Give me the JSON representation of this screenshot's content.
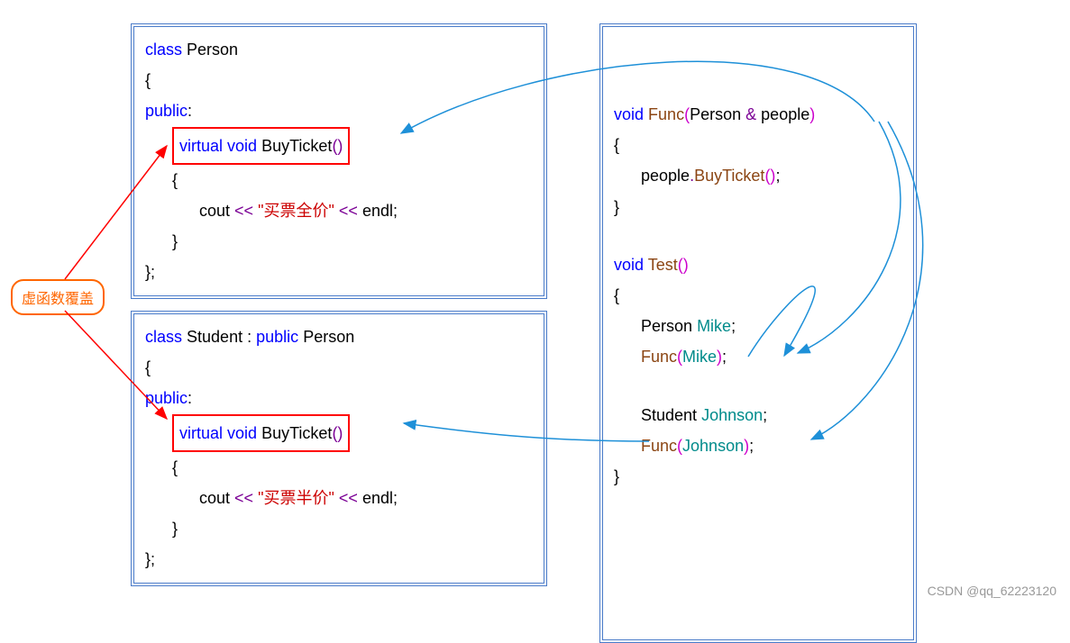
{
  "callout": {
    "label": "虚函数覆盖"
  },
  "box1": {
    "l1_class": "class",
    "l1_name": "Person",
    "l2_brace": "{",
    "l3_public": "public",
    "l3_colon": ":",
    "l4_virtual": "virtual",
    "l4_void": "void",
    "l4_fn": "BuyTicket",
    "l4_paren": "()",
    "l5_brace": "{",
    "l6_cout": "cout",
    "l6_op1": "<<",
    "l6_str": "\"买票全价\"",
    "l6_op2": "<<",
    "l6_endl": "endl",
    "l6_semi": ";",
    "l7_brace": "}",
    "l8_brace": "};"
  },
  "box2": {
    "l1_class": "class",
    "l1_name": "Student",
    "l1_colon": ":",
    "l1_public": "public",
    "l1_base": "Person",
    "l2_brace": "{",
    "l3_public": "public",
    "l3_colon": ":",
    "l4_virtual": "virtual",
    "l4_void": "void",
    "l4_fn": "BuyTicket",
    "l4_paren": "()",
    "l5_brace": "{",
    "l6_cout": "cout",
    "l6_op1": "<<",
    "l6_str": "\"买票半价\"",
    "l6_op2": "<<",
    "l6_endl": "endl",
    "l6_semi": ";",
    "l7_brace": "}",
    "l8_brace": "};"
  },
  "box3": {
    "l1_void": "void",
    "l1_fn": "Func",
    "l1_paren_o": "(",
    "l1_type": "Person",
    "l1_amp": "&",
    "l1_param": "people",
    "l1_paren_c": ")",
    "l2_brace": "{",
    "l3_obj": "people",
    "l3_dot": ".",
    "l3_call": "BuyTicket",
    "l3_paren": "()",
    "l3_semi": ";",
    "l4_brace": "}",
    "l5_void": "void",
    "l5_fn": "Test",
    "l5_paren": "()",
    "l6_brace": "{",
    "l7_type": "Person",
    "l7_name": "Mike",
    "l7_semi": ";",
    "l8_fn": "Func",
    "l8_paren_o": "(",
    "l8_arg": "Mike",
    "l8_paren_c": ")",
    "l8_semi": ";",
    "l9_type": "Student",
    "l9_name": "Johnson",
    "l9_semi": ";",
    "l10_fn": "Func",
    "l10_paren_o": "(",
    "l10_arg": "Johnson",
    "l10_paren_c": ")",
    "l10_semi": ";",
    "l11_brace": "}"
  },
  "watermark": "CSDN @qq_62223120"
}
